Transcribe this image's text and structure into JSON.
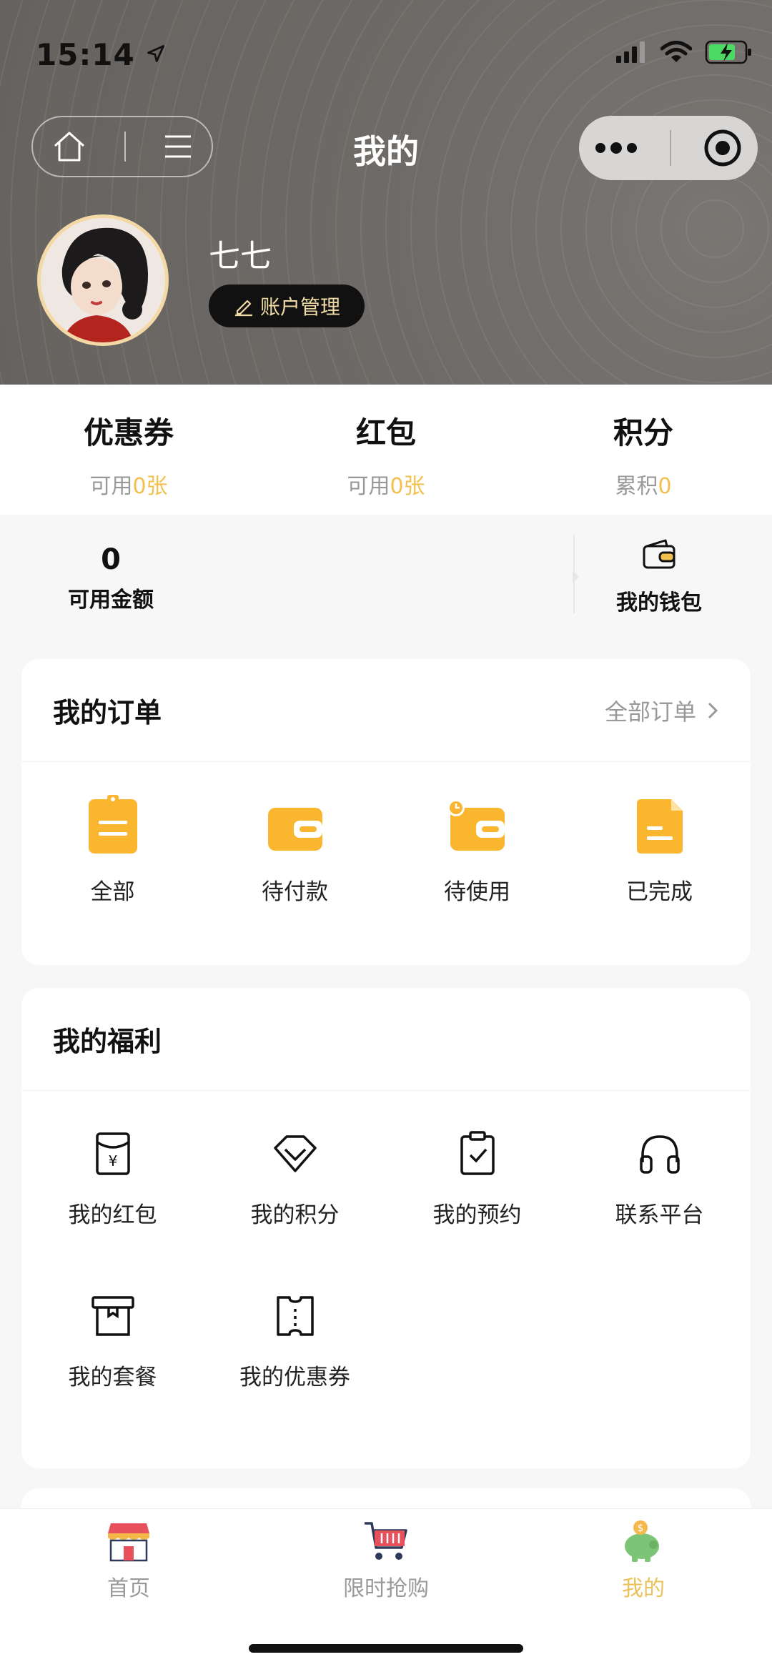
{
  "status_bar": {
    "time": "15:14"
  },
  "nav": {
    "title": "我的"
  },
  "profile": {
    "name": "七七",
    "account_button": "账户管理"
  },
  "stats": [
    {
      "title": "优惠券",
      "prefix": "可用",
      "value": "0",
      "suffix": "张"
    },
    {
      "title": "红包",
      "prefix": "可用",
      "value": "0",
      "suffix": "张"
    },
    {
      "title": "积分",
      "prefix": "累积",
      "value": "0",
      "suffix": ""
    }
  ],
  "wallet": {
    "amount": "0",
    "amount_label": "可用金额",
    "wallet_label": "我的钱包"
  },
  "orders": {
    "title": "我的订单",
    "link": "全部订单",
    "items": [
      {
        "label": "全部",
        "icon": "clipboard-icon"
      },
      {
        "label": "待付款",
        "icon": "wallet-icon"
      },
      {
        "label": "待使用",
        "icon": "wallet-clock-icon"
      },
      {
        "label": "已完成",
        "icon": "document-icon"
      }
    ]
  },
  "benefits": {
    "title": "我的福利",
    "items": [
      {
        "label": "我的红包",
        "icon": "red-packet-icon"
      },
      {
        "label": "我的积分",
        "icon": "diamond-icon"
      },
      {
        "label": "我的预约",
        "icon": "clipboard-check-icon"
      },
      {
        "label": "联系平台",
        "icon": "headphones-icon"
      },
      {
        "label": "我的套餐",
        "icon": "package-icon"
      },
      {
        "label": "我的优惠券",
        "icon": "ticket-icon"
      }
    ]
  },
  "tabbar": [
    {
      "label": "首页",
      "icon": "shop-icon"
    },
    {
      "label": "限时抢购",
      "icon": "cart-icon"
    },
    {
      "label": "我的",
      "icon": "piggy-bank-icon",
      "active": true
    }
  ],
  "colors": {
    "accent": "#f3c04d",
    "order_icon": "#fbb62f",
    "header_bg": "#6f6b68"
  }
}
